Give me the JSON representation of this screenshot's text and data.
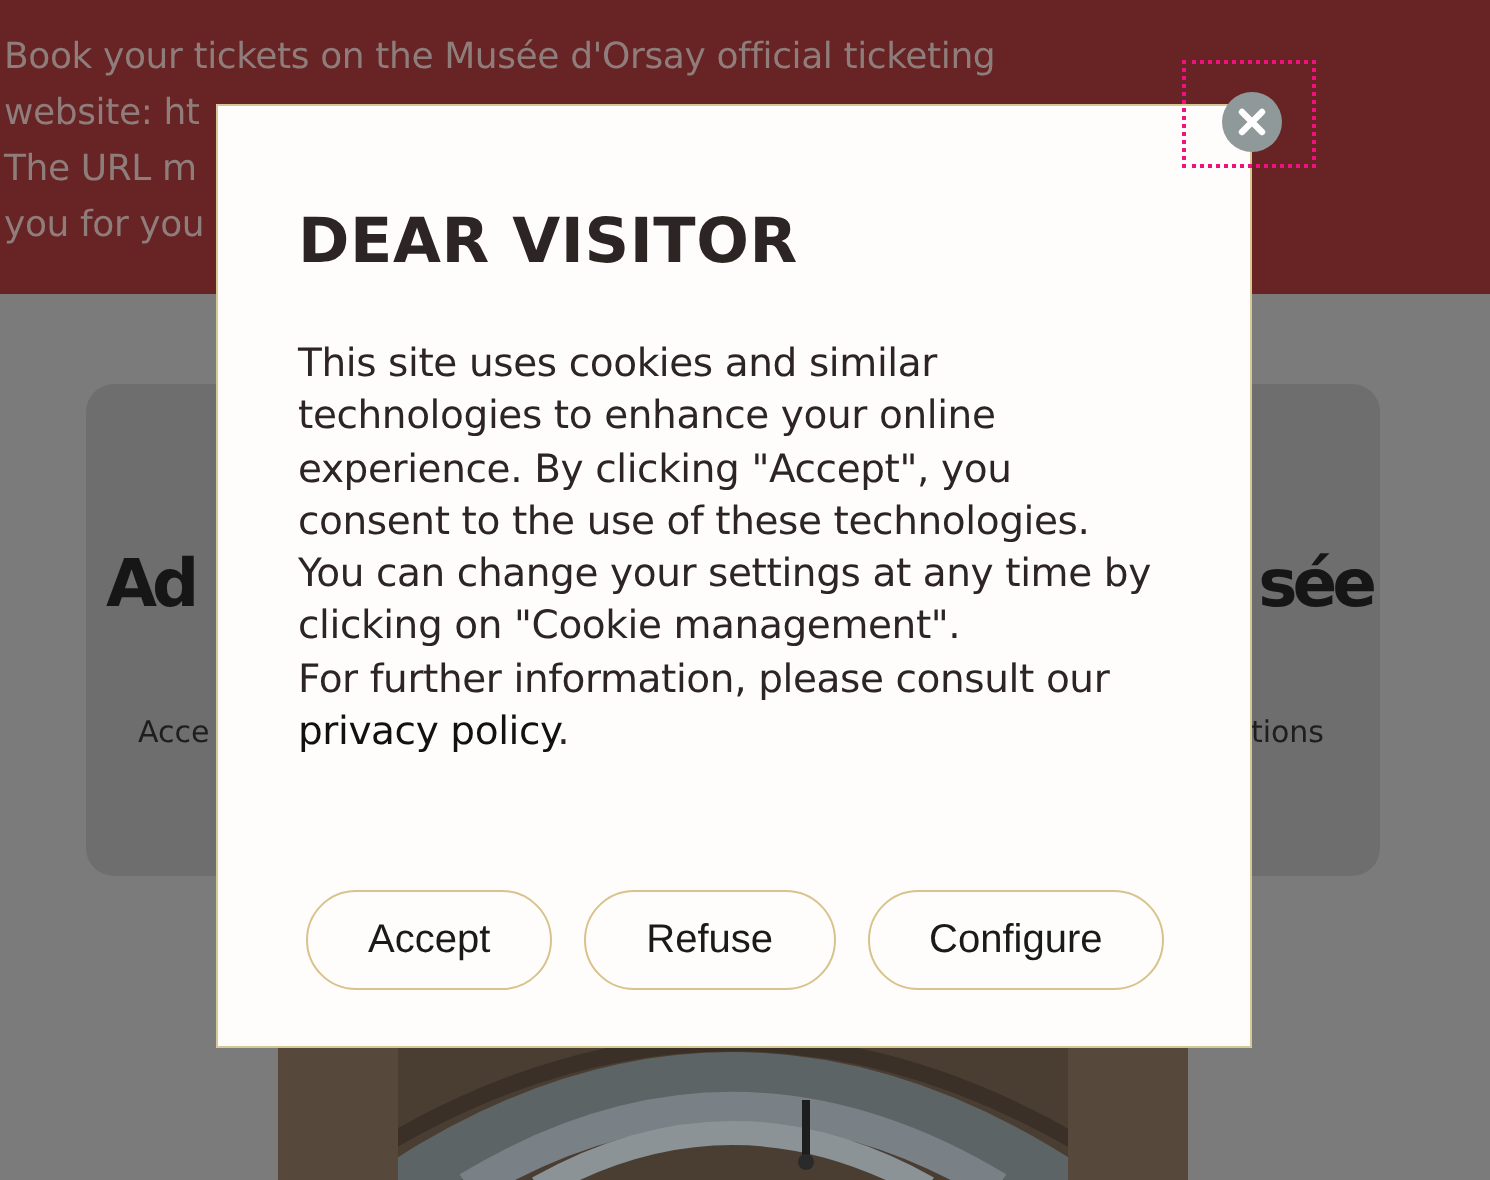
{
  "banner": {
    "lines": [
      "Book your tickets on the Musée d'Orsay official ticketing",
      "website: ht",
      "The URL m",
      "you for you"
    ]
  },
  "card": {
    "title_left": "Ad",
    "title_right": "sée",
    "text_left": "Acce",
    "text_right": "tions"
  },
  "dialog": {
    "title": "DEAR VISITOR",
    "paragraph": "This site uses cookies and similar technologies to enhance your online experience. By clicking \"Accept\", you consent to the use of these technologies. You can change your settings at any time by clicking on \"Cookie management\".",
    "info": {
      "text": "For further information, please consult our ",
      "link": "privacy policy",
      "after": "."
    },
    "close_button": {
      "focused": true
    },
    "buttons": [
      "Accept",
      "Refuse",
      "Configure"
    ]
  }
}
